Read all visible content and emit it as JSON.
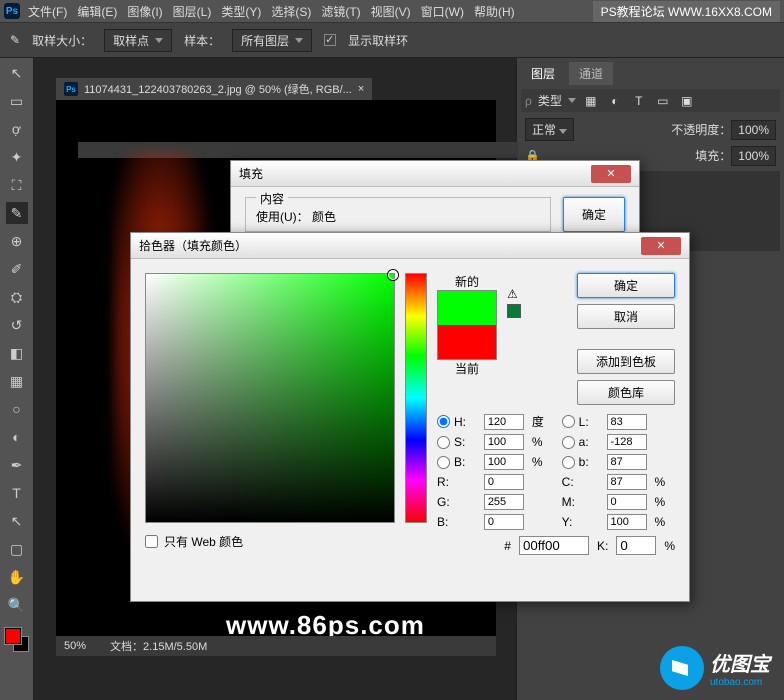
{
  "menu": [
    "文件(F)",
    "编辑(E)",
    "图像(I)",
    "图层(L)",
    "类型(Y)",
    "选择(S)",
    "滤镜(T)",
    "视图(V)",
    "窗口(W)",
    "帮助(H)"
  ],
  "watermark": "PS教程论坛 WWW.16XX8.COM",
  "optbar": {
    "label1": "取样大小：",
    "dd1": "取样点",
    "label2": "样本：",
    "dd2": "所有图层",
    "chk": "显示取样环"
  },
  "doc": {
    "title": "11074431_122403780263_2.jpg @ 50% (绿色, RGB/...",
    "zoom": "50%",
    "doclabel": "文档：",
    "docsize": "2.15M/5.50M",
    "wm": "www.86ps.com"
  },
  "panels": {
    "tab1": "图层",
    "tab2": "通道",
    "type": "类型",
    "blend": "正常",
    "opacity_l": "不透明度：",
    "opacity_v": "100%",
    "fill_l": "填充：",
    "fill_v": "100%"
  },
  "fill_dlg": {
    "title": "填充",
    "content": "内容",
    "use": "使用(U)：",
    "use_v": "颜色",
    "ok": "确定"
  },
  "picker": {
    "title": "拾色器（填充颜色）",
    "ok": "确定",
    "cancel": "取消",
    "add": "添加到色板",
    "lib": "颜色库",
    "new": "新的",
    "cur": "当前",
    "H": "H:",
    "Hv": "120",
    "Hu": "度",
    "S": "S:",
    "Sv": "100",
    "Su": "%",
    "B": "B:",
    "Bv": "100",
    "Bu": "%",
    "R": "R:",
    "Rv": "0",
    "G": "G:",
    "Gv": "255",
    "Bl": "B:",
    "Blv": "0",
    "L": "L:",
    "Lv": "83",
    "a": "a:",
    "av": "-128",
    "b2": "b:",
    "b2v": "87",
    "C": "C:",
    "Cv": "87",
    "Cu": "%",
    "M": "M:",
    "Mv": "0",
    "Mu": "%",
    "Y": "Y:",
    "Yv": "100",
    "Yu": "%",
    "K": "K:",
    "Kv": "0",
    "Ku": "%",
    "hex_l": "#",
    "hex": "00ff00",
    "web": "只有 Web 颜色"
  },
  "colors": {
    "new": "#00ff00",
    "cur": "#ff0000"
  },
  "brand": {
    "name": "优图宝",
    "url": "utobao.com"
  }
}
